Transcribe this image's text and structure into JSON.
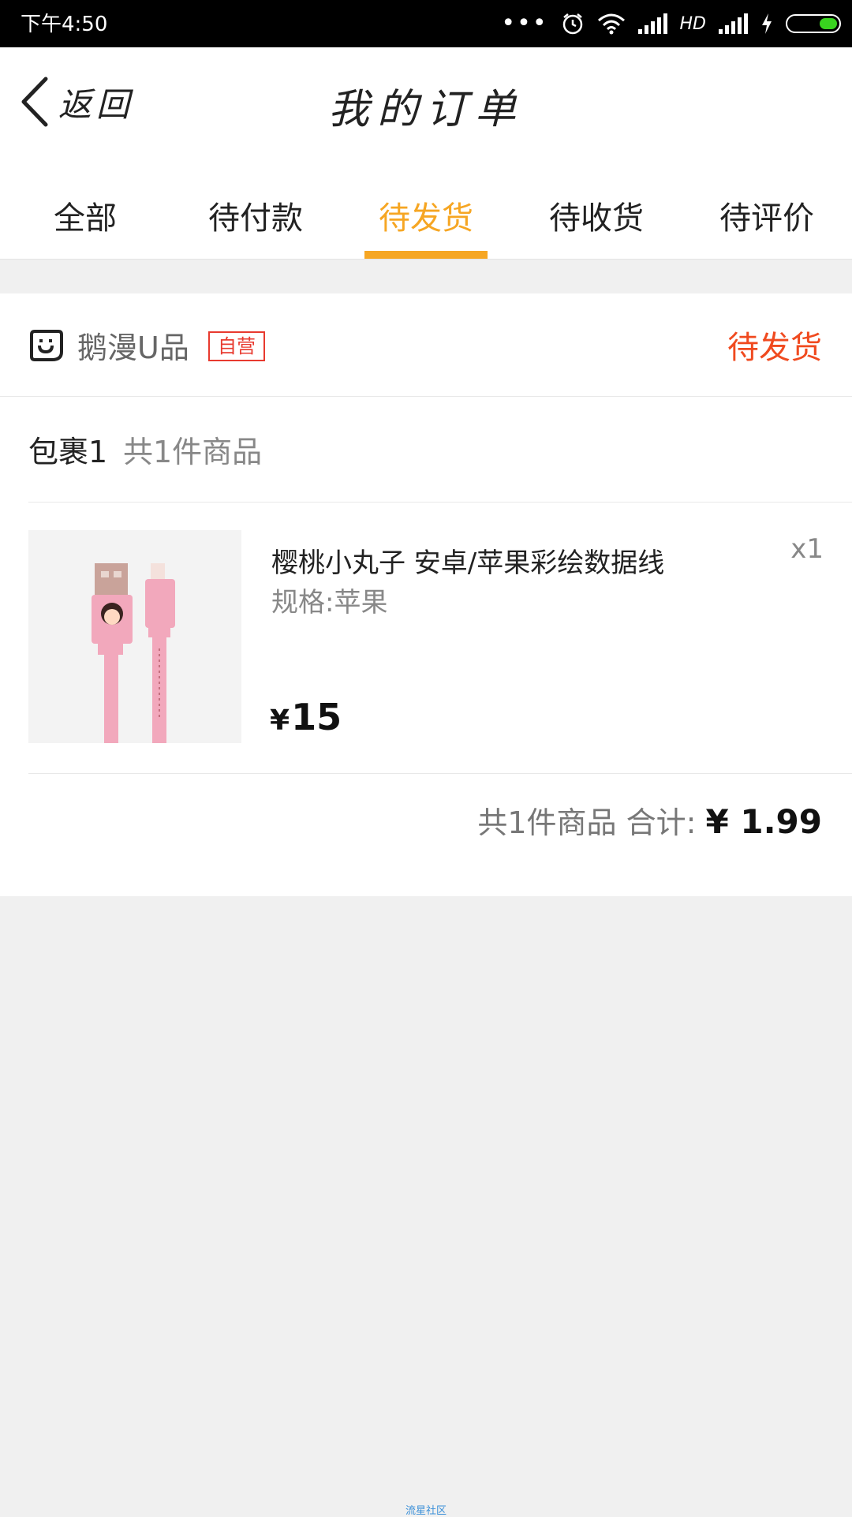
{
  "status_bar": {
    "time": "下午4:50",
    "network": "HD"
  },
  "header": {
    "back_label": "返回",
    "title": "我的订单"
  },
  "tabs": [
    {
      "label": "全部",
      "active": false
    },
    {
      "label": "待付款",
      "active": false
    },
    {
      "label": "待发货",
      "active": true
    },
    {
      "label": "待收货",
      "active": false
    },
    {
      "label": "待评价",
      "active": false
    }
  ],
  "order": {
    "store_name": "鹅漫U品",
    "store_badge": "自营",
    "status": "待发货",
    "package_label": "包裹1",
    "package_count": "共1件商品",
    "product": {
      "title": "樱桃小丸子 安卓/苹果彩绘数据线",
      "spec": "规格:苹果",
      "quantity": "x1",
      "currency": "¥",
      "price": "15"
    },
    "summary_text": "共1件商品 合计:",
    "summary_total": "¥ 1.99"
  },
  "footer": {
    "watermark": "流星社区"
  },
  "colors": {
    "accent": "#f6a623",
    "status_red": "#f04a1f",
    "badge_red": "#e83a2f",
    "page_bg": "#f0f0f0"
  }
}
